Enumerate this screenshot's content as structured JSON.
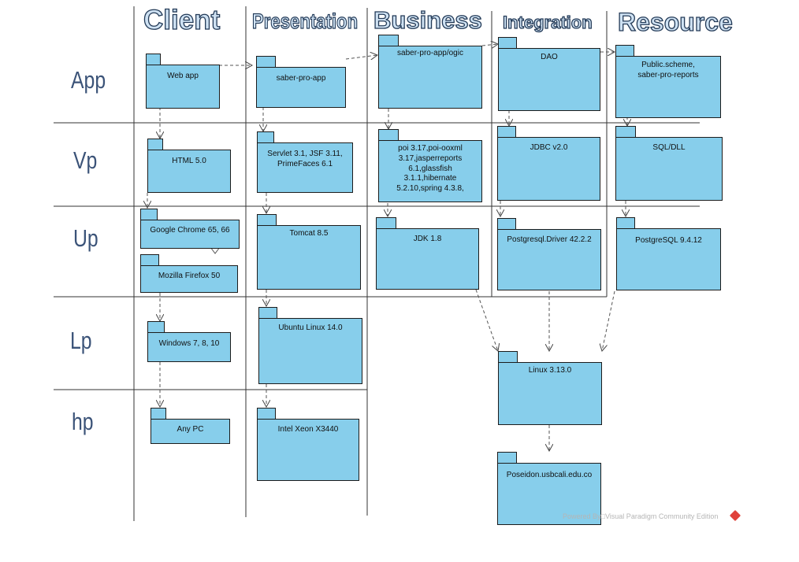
{
  "columns": {
    "client": "Client",
    "presentation": "Presentation",
    "business": "Business",
    "integration": "Integration",
    "resource": "Resource"
  },
  "rows": {
    "app": "App",
    "vp": "Vp",
    "up": "Up",
    "lp": "Lp",
    "hp": "hp"
  },
  "packages": {
    "web_app": "Web app",
    "saber_pro_app": "saber-pro-app",
    "saber_pro_logic": "saber-pro-app/ogic",
    "dao": "DAO",
    "public_scheme": "Public.scheme,\nsaber-pro-reports",
    "html5": "HTML 5.0",
    "servlet": "Servlet 3.1, JSF 3.11,\nPrimeFaces 6.1",
    "poi": "poi 3.17,poi-ooxml\n3.17,jasperreports\n6.1,glassfish\n3.1.1,hibernate\n5.2.10,spring 4.3.8,",
    "jdbc": "JDBC v2.0",
    "sql_dll": "SQL/DLL",
    "chrome": "Google Chrome 65, 66",
    "firefox": "Mozilla Firefox 50",
    "tomcat": "Tomcat 8.5",
    "jdk": "JDK 1.8",
    "pg_driver": "Postgresql.Driver 42.2.2",
    "postgresql": "PostgreSQL 9.4.12",
    "windows": "Windows 7, 8, 10",
    "ubuntu": "Ubuntu Linux 14.0",
    "linux": "Linux 3.13.0",
    "any_pc": "Any PC",
    "xeon": "Intel Xeon X3440",
    "poseidon": "Poseidon.usbcali.edu.co"
  },
  "watermark": "Powered By□Visual Paradigm Community Edition",
  "colors": {
    "package_fill": "#87ceeb",
    "border": "#1c1c1c",
    "heading_fill": "#cfe2f3",
    "heading_stroke": "#233a57",
    "row_label": "#3b5378",
    "logo": "#e0413a"
  }
}
